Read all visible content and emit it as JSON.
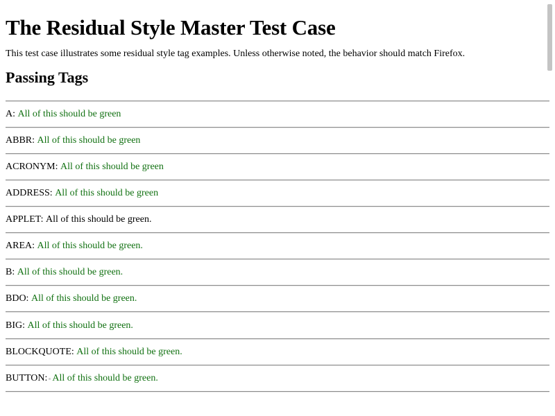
{
  "title": "The Residual Style Master Test Case",
  "intro": "This test case illustrates some residual style tag examples. Unless otherwise noted, the behavior should match Firefox.",
  "section_heading": "Passing Tags",
  "colors": {
    "green_text": "#107010",
    "rule": "#8c8c8c"
  },
  "rows": [
    {
      "tag": "A:",
      "text": "All of this should be green",
      "color": "green"
    },
    {
      "tag": "ABBR:",
      "text": "All of this should be green",
      "color": "green"
    },
    {
      "tag": "ACRONYM:",
      "text": "All of this should be green",
      "color": "green"
    },
    {
      "tag": "ADDRESS:",
      "text": "All of this should be green",
      "color": "green"
    },
    {
      "tag": "APPLET:",
      "text": "All of this should be green.",
      "color": "black"
    },
    {
      "tag": "AREA:",
      "text": "All of this should be green.",
      "color": "green"
    },
    {
      "tag": "B:",
      "text": "All of this should be green.",
      "color": "green"
    },
    {
      "tag": "BDO:",
      "text": "All of this should be green.",
      "color": "green"
    },
    {
      "tag": "BIG:",
      "text": "All of this should be green.",
      "color": "green"
    },
    {
      "tag": "BLOCKQUOTE:",
      "text": "All of this should be green.",
      "color": "green"
    },
    {
      "tag": "BUTTON:",
      "text": "All of this should be green.",
      "color": "green"
    }
  ]
}
